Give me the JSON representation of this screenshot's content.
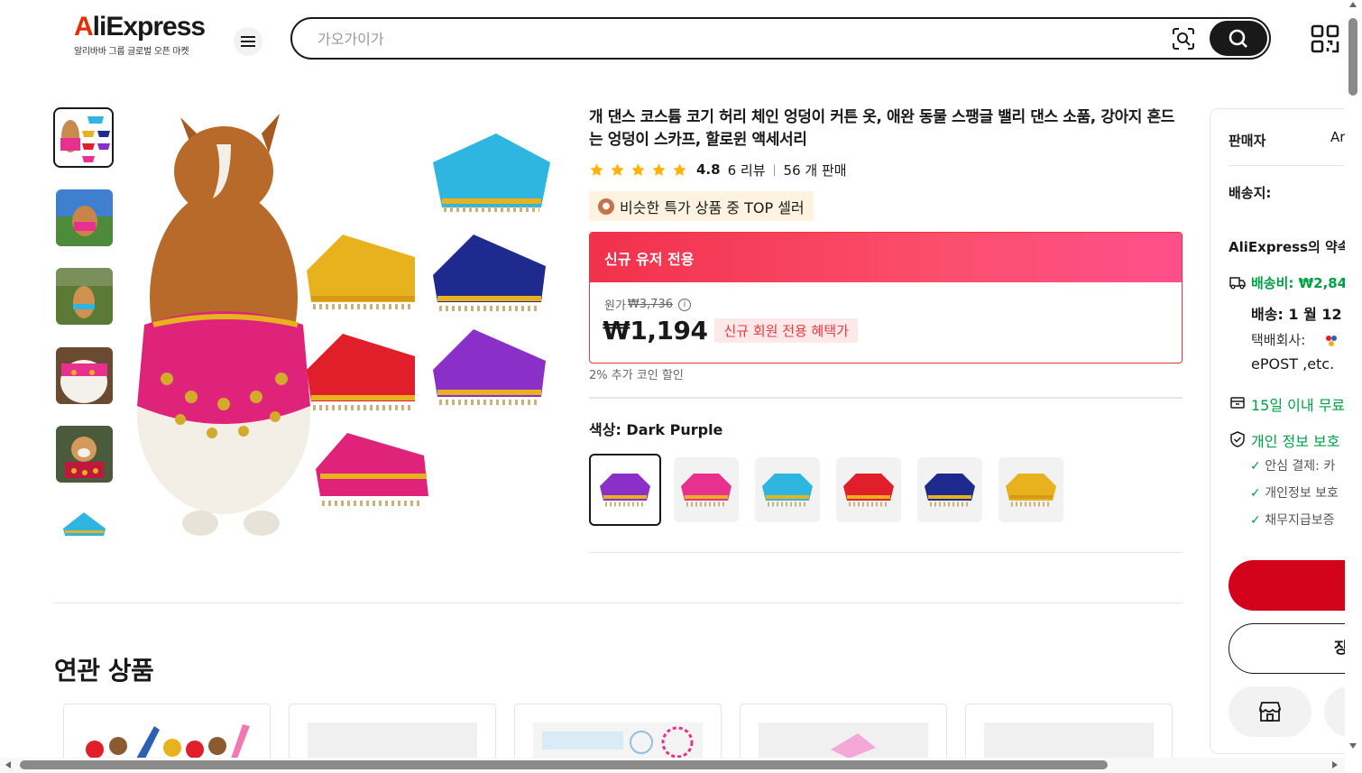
{
  "header": {
    "logo_text": "AliExpress",
    "logo_tagline": "알리바바 그룹 글로벌 오픈 마켓",
    "search_placeholder": "가오가이가",
    "icons": [
      "menu-icon",
      "camera-search-icon",
      "search-icon",
      "qr-code-icon"
    ]
  },
  "gallery": {
    "thumbnails": [
      "thumb-1",
      "thumb-2",
      "thumb-3",
      "thumb-4",
      "thumb-5",
      "thumb-6"
    ],
    "selected_index": 0
  },
  "product": {
    "title": "개 댄스 코스튬 코기 허리 체인 엉덩이 커튼 옷, 애완 동물 스팽글 밸리 댄스 소품, 강아지 흔드는 엉덩이 스카프, 할로윈 액세서리",
    "rating": "4.8",
    "reviews": "6 리뷰",
    "sold": "56 개 판매",
    "stars": 5,
    "badge": "비슷한 특가 상품 중 TOP 셀러",
    "promo_header": "신규 유저 전용",
    "original_price_label": "원가",
    "original_price": "₩3,736",
    "price": "₩1,194",
    "price_badge": "신규 회원 전용 혜택가",
    "coin_discount": "2% 추가 코인 할인",
    "color_label": "색상: ",
    "color_value": "Dark Purple",
    "swatches": [
      "Dark Purple",
      "Rose Red",
      "Sky Blue",
      "Red",
      "Navy Blue",
      "Yellow"
    ],
    "swatch_colors": [
      "#8b2fc9",
      "#e8308f",
      "#2fb6e0",
      "#e01f2a",
      "#1f2a8f",
      "#e8b21f"
    ]
  },
  "related": {
    "title": "연관 상품"
  },
  "panel": {
    "seller_label": "판매자",
    "seller_value": "Ar",
    "ship_to_label": "배송지:",
    "promise_title": "AliExpress의 약속",
    "shipping_fee": "배송비: ₩2,84",
    "delivery": "배송: 1 월 12",
    "carrier_label": "택배회사:",
    "carrier_value": "ePOST ,etc.",
    "returns": "15일 이내 무료",
    "privacy": "개인 정보 보호",
    "checks": [
      "안심 결제: 카",
      "개인정보 보호",
      "채무지급보증"
    ],
    "secondary_btn": "장"
  },
  "colors": {
    "accent": "#e62e04",
    "promo_red": "#e8383d",
    "buy_red": "#d3031c",
    "green": "#00a046"
  }
}
